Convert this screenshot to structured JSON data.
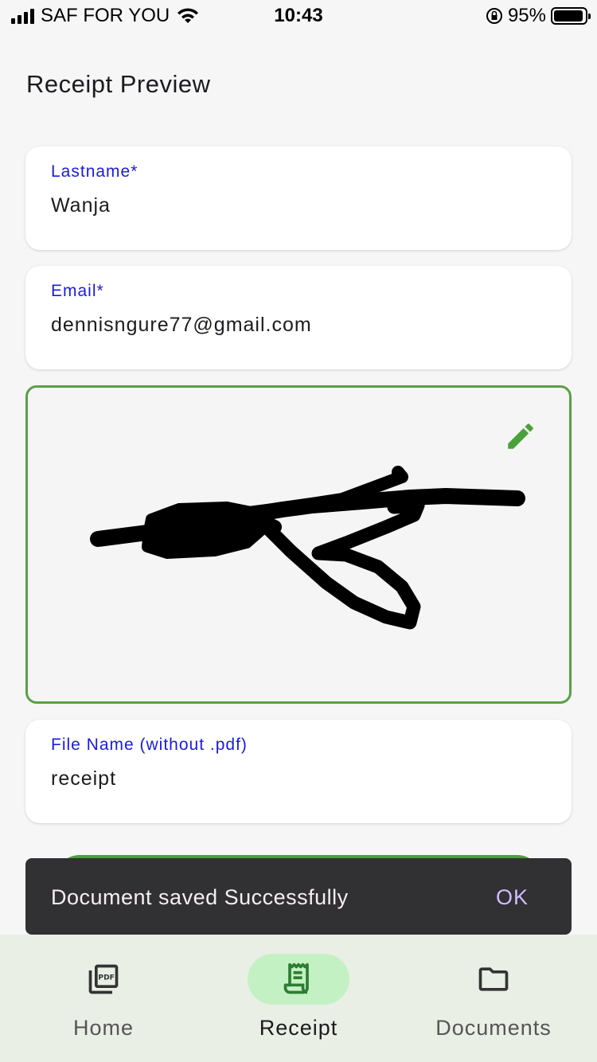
{
  "status_bar": {
    "carrier": "SAF FOR YOU",
    "time": "10:43",
    "battery_percent": "95%",
    "battery_level": 0.95
  },
  "page": {
    "title": "Receipt Preview"
  },
  "form": {
    "lastname": {
      "label": "Lastname*",
      "value": "Wanja"
    },
    "email": {
      "label": "Email*",
      "value": "dennisngure77@gmail.com"
    },
    "filename": {
      "label": "File Name (without .pdf)",
      "value": "receipt"
    }
  },
  "signature": {
    "edit_icon": "pencil-icon",
    "border_color": "#5aa046"
  },
  "snackbar": {
    "message": "Document saved Successfully",
    "action": "OK"
  },
  "bottom_nav": {
    "items": [
      {
        "label": "Home",
        "icon": "pdf-icon",
        "active": false
      },
      {
        "label": "Receipt",
        "icon": "receipt-icon",
        "active": true
      },
      {
        "label": "Documents",
        "icon": "folder-icon",
        "active": false
      }
    ],
    "active_indicator_color": "#c4f1c4"
  },
  "colors": {
    "accent": "#4aa23a",
    "label": "#1a1ae6",
    "snackbar_bg": "#313033",
    "snackbar_action": "#d0bcff"
  }
}
